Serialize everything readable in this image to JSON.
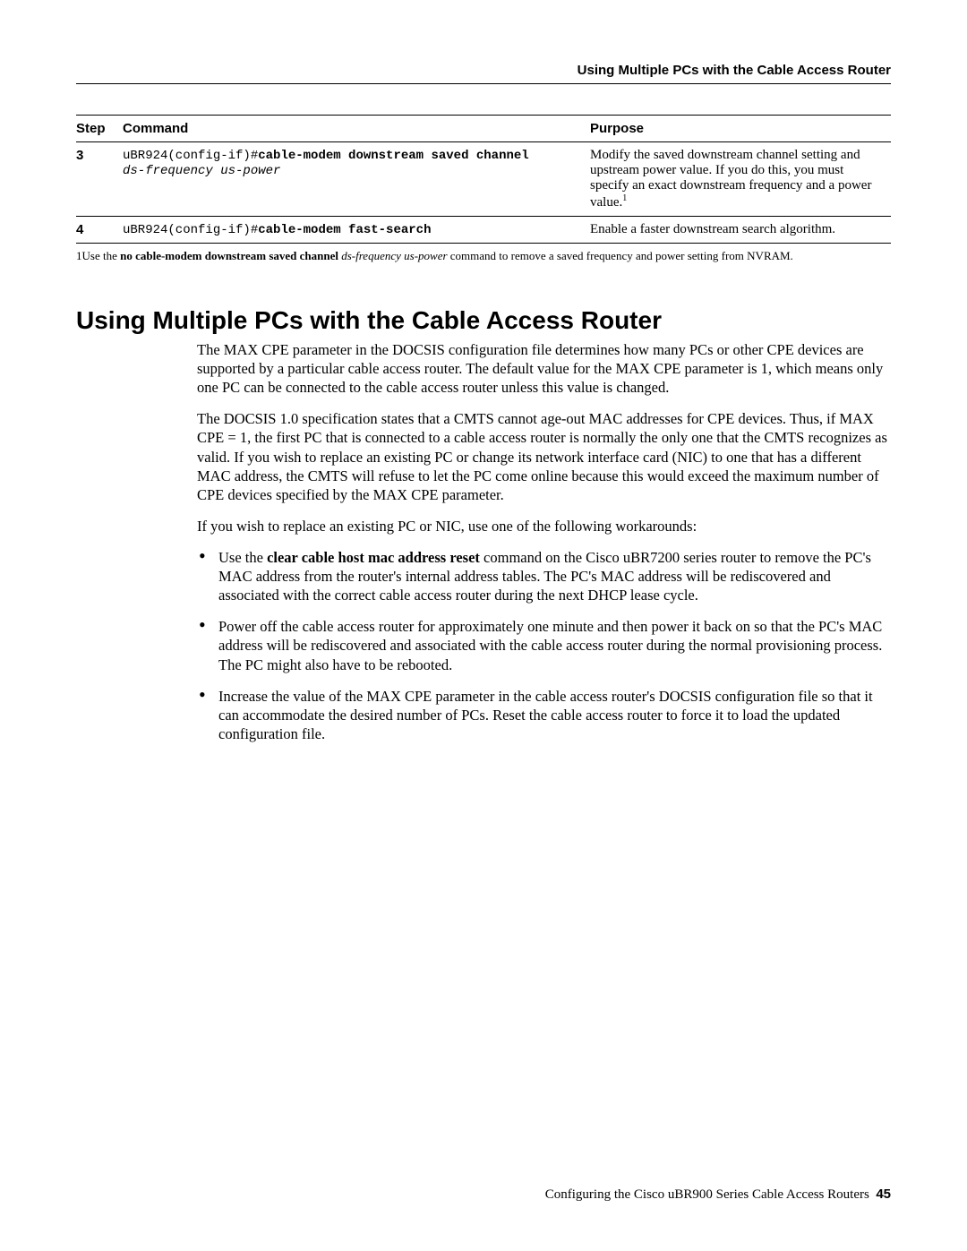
{
  "running_head": "Using Multiple PCs with the Cable Access Router",
  "table": {
    "headers": {
      "step": "Step",
      "command": "Command",
      "purpose": "Purpose"
    },
    "rows": [
      {
        "step": "3",
        "cmd_prefix": "uBR924(config-if)#",
        "cmd_bold": "cable-modem downstream saved channel",
        "cmd_italic": "ds-frequency us-power",
        "purpose_a": "Modify the saved downstream channel setting and upstream power value. If you do this, you must specify an exact downstream frequency and a power value.",
        "sup": "1"
      },
      {
        "step": "4",
        "cmd_prefix": "uBR924(config-if)#",
        "cmd_bold": "cable-modem fast-search",
        "cmd_italic": "",
        "purpose_a": "Enable a faster downstream search algorithm.",
        "sup": ""
      }
    ]
  },
  "footnote": {
    "num": "1",
    "a": "Use the ",
    "bold": "no cable-modem downstream saved channel",
    "space": " ",
    "italic": "ds-frequency us-power",
    "b": " command to remove a saved frequency and power setting from NVRAM."
  },
  "section_title": "Using Multiple PCs with the Cable Access Router",
  "paras": {
    "p1": "The MAX CPE parameter in the DOCSIS configuration file determines how many PCs or other CPE devices are supported by a particular cable access router. The default value for the MAX CPE parameter is 1, which means only one PC can be connected to the cable access router unless this value is changed.",
    "p2": "The DOCSIS 1.0 specification states that a CMTS cannot age-out MAC addresses for CPE devices. Thus, if MAX CPE = 1, the first PC that is connected to a cable access router is normally the only one that the CMTS recognizes as valid. If you wish to replace an existing PC or change its network interface card (NIC) to one that has a different MAC address, the CMTS will refuse to let the PC come online because this would exceed the maximum number of CPE devices specified by the MAX CPE parameter.",
    "p3": "If you wish to replace an existing PC or NIC, use one of the following workarounds:"
  },
  "bullets": [
    {
      "a": "Use the ",
      "bold": "clear cable host mac address reset",
      "b": " command on the Cisco uBR7200 series router to remove the PC's MAC address from the router's internal address tables. The PC's MAC address will be rediscovered and associated with the correct cable access router during the next DHCP lease cycle."
    },
    {
      "a": "",
      "bold": "",
      "b": "Power off the cable access router for approximately one minute and then power it back on so that the PC's MAC address will be rediscovered and associated with the cable access router during the normal provisioning process. The PC might also have to be rebooted."
    },
    {
      "a": "",
      "bold": "",
      "b": "Increase the value of the MAX CPE  parameter in the cable access router's DOCSIS configuration file so that it can accommodate the desired number of PCs. Reset the cable access router to force it to load the updated configuration file."
    }
  ],
  "footer": {
    "text": "Configuring the Cisco uBR900 Series Cable Access Routers",
    "page": "45"
  }
}
